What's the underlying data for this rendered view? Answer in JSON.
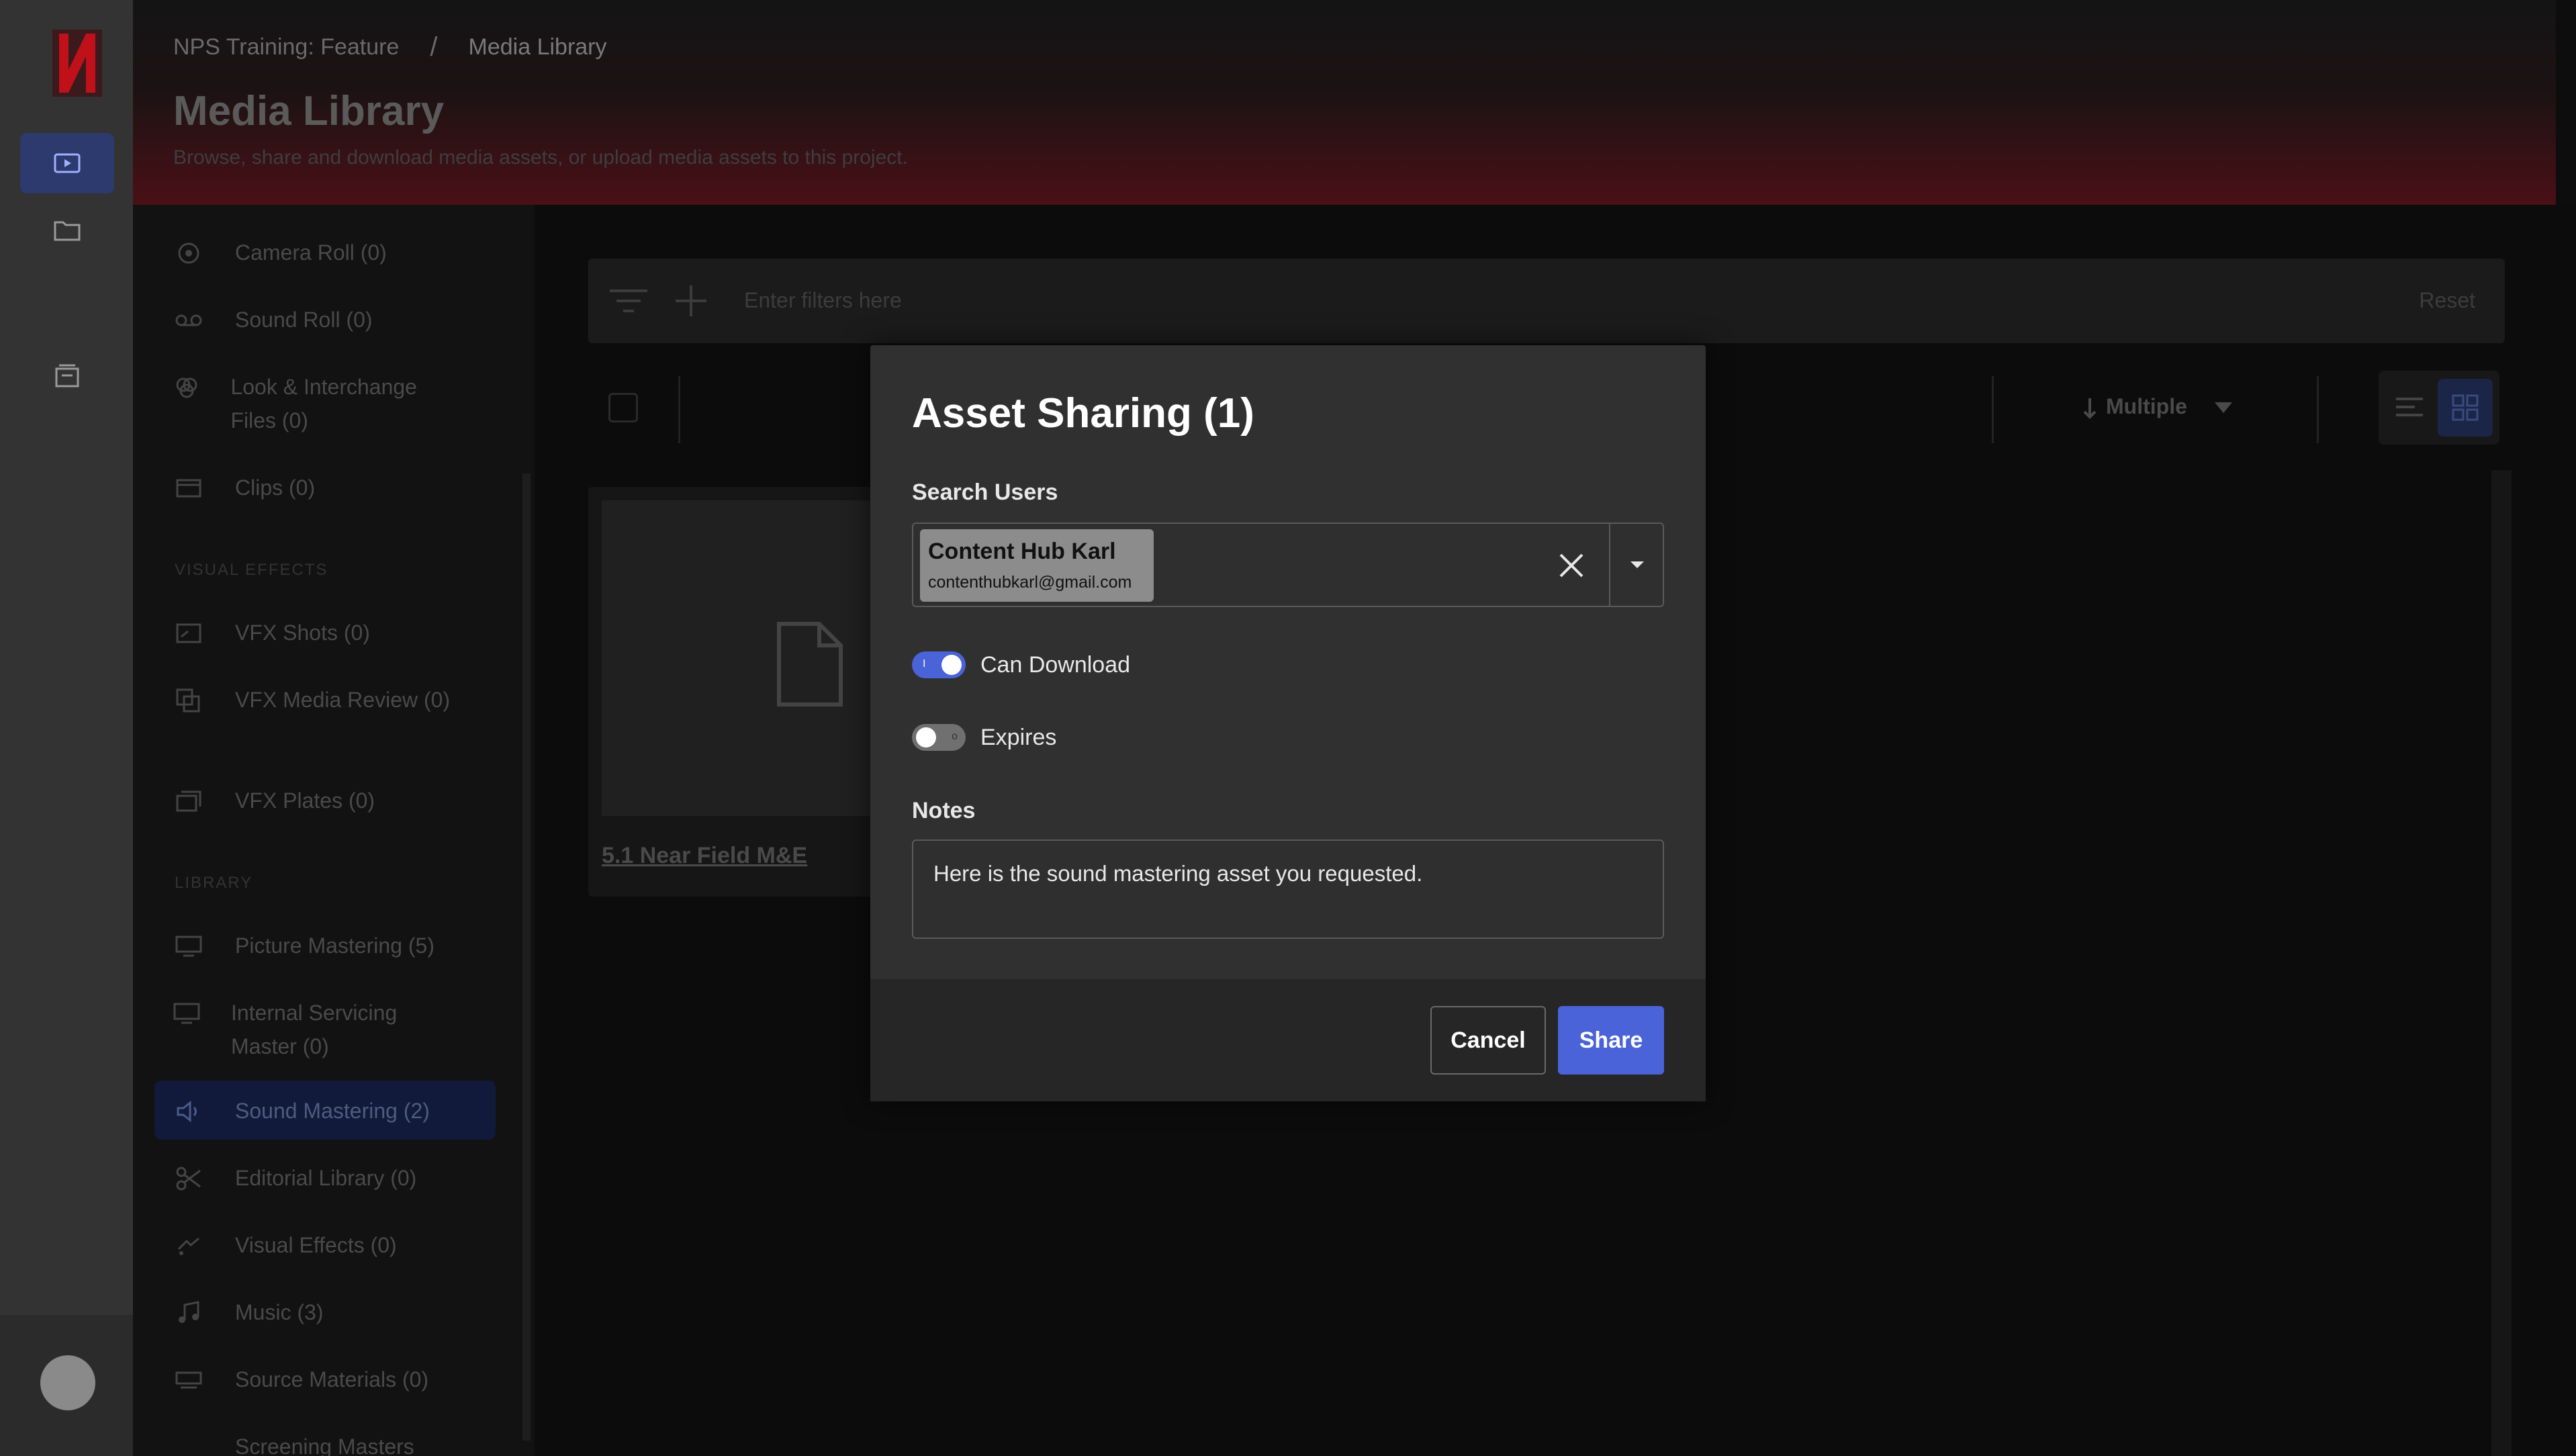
{
  "colors": {
    "accent": "#4a63d8",
    "brand": "#e50914",
    "modal_bg": "#303030"
  },
  "header": {
    "breadcrumbs": [
      "NPS Training: Feature",
      "Media Library"
    ],
    "separator": "/",
    "title": "Media Library",
    "subtitle": "Browse, share and download media assets, or upload media assets to this project."
  },
  "rail": {
    "items": [
      {
        "icon": "play-icon",
        "active": true
      },
      {
        "icon": "folder-icon",
        "active": false
      },
      {
        "icon": "inbox-icon",
        "active": false
      }
    ]
  },
  "nav": {
    "items": [
      {
        "label": "Camera Roll (0)",
        "icon": "camera-icon"
      },
      {
        "label": "Sound Roll (0)",
        "icon": "tape-icon"
      },
      {
        "label": "Look & Interchange Files (0)",
        "icon": "lut-icon"
      },
      {
        "label": "Clips (0)",
        "icon": "clip-icon"
      },
      {
        "label": "VFX Shots (0)",
        "icon": "shot-icon"
      },
      {
        "label": "VFX Media Review (0)",
        "icon": "review-icon"
      },
      {
        "label": "VFX Plates (0)",
        "icon": "plates-icon"
      },
      {
        "label": "Picture Mastering (5)",
        "icon": "monitor-icon"
      },
      {
        "label": "Internal Servicing Master (0)",
        "icon": "monitor-icon"
      },
      {
        "label": "Sound Mastering (2)",
        "icon": "speaker-icon"
      },
      {
        "label": "Editorial Library (0)",
        "icon": "scissors-icon"
      },
      {
        "label": "Visual Effects (0)",
        "icon": "effects-icon"
      },
      {
        "label": "Music (3)",
        "icon": "music-icon"
      },
      {
        "label": "Source Materials (0)",
        "icon": "source-icon"
      },
      {
        "label": "Screening Masters",
        "icon": "screen-icon"
      }
    ],
    "sections": [
      "VISUAL EFFECTS",
      "LIBRARY"
    ]
  },
  "main": {
    "filter_placeholder": "Enter filters here",
    "reset_label": "Reset",
    "sort_label": "Multiple",
    "asset_card_title": "5.1 Near Field M&E"
  },
  "modal": {
    "title": "Asset Sharing (1)",
    "search_label": "Search Users",
    "selected_user": {
      "name": "Content Hub Karl",
      "email": "contenthubkarl@gmail.com"
    },
    "can_download": {
      "label": "Can Download",
      "on": true
    },
    "expires": {
      "label": "Expires",
      "on": false
    },
    "notes_label": "Notes",
    "notes_value": "Here is the sound mastering asset you requested.",
    "cancel_label": "Cancel",
    "share_label": "Share"
  }
}
